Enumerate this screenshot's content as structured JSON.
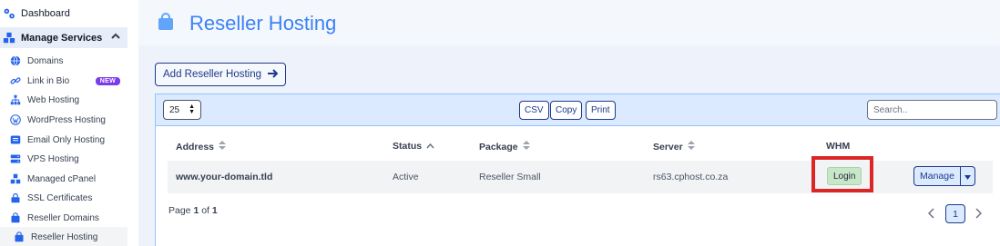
{
  "sidebar": {
    "dashboard": "Dashboard",
    "group": "Manage Services",
    "items": [
      {
        "label": "Domains",
        "icon": "globe-icon"
      },
      {
        "label": "Link in Bio",
        "icon": "link-icon",
        "badge": "NEW"
      },
      {
        "label": "Web Hosting",
        "icon": "sitemap-icon"
      },
      {
        "label": "WordPress Hosting",
        "icon": "wordpress-icon"
      },
      {
        "label": "Email Only Hosting",
        "icon": "envelope-icon"
      },
      {
        "label": "VPS Hosting",
        "icon": "server-icon"
      },
      {
        "label": "Managed cPanel",
        "icon": "cubes-icon"
      },
      {
        "label": "SSL Certificates",
        "icon": "lock-icon"
      },
      {
        "label": "Reseller Domains",
        "icon": "bag-icon"
      },
      {
        "label": "Reseller Hosting",
        "icon": "bag-icon"
      }
    ]
  },
  "header": {
    "title": "Reseller Hosting",
    "icon": "shopping-bag-icon"
  },
  "add_button": "Add Reseller Hosting",
  "toolbar": {
    "page_length": "25",
    "csv": "CSV",
    "copy": "Copy",
    "print": "Print",
    "search_placeholder": "Search.."
  },
  "table": {
    "columns": [
      "Address",
      "Status",
      "Package",
      "Server",
      "WHM"
    ],
    "rows": [
      {
        "address": "www.your-domain.tld",
        "status": "Active",
        "package": "Reseller Small",
        "server": "rs63.cphost.co.za",
        "whm": "Login",
        "action": "Manage"
      }
    ]
  },
  "pagination": {
    "page_word": "Page",
    "current": "1",
    "of_word": "of",
    "total": "1",
    "button": "1"
  },
  "colors": {
    "accent": "#3b82f6",
    "highlight": "#dc2626",
    "badge": "#7c3aed",
    "login": "#c8e6c9"
  }
}
